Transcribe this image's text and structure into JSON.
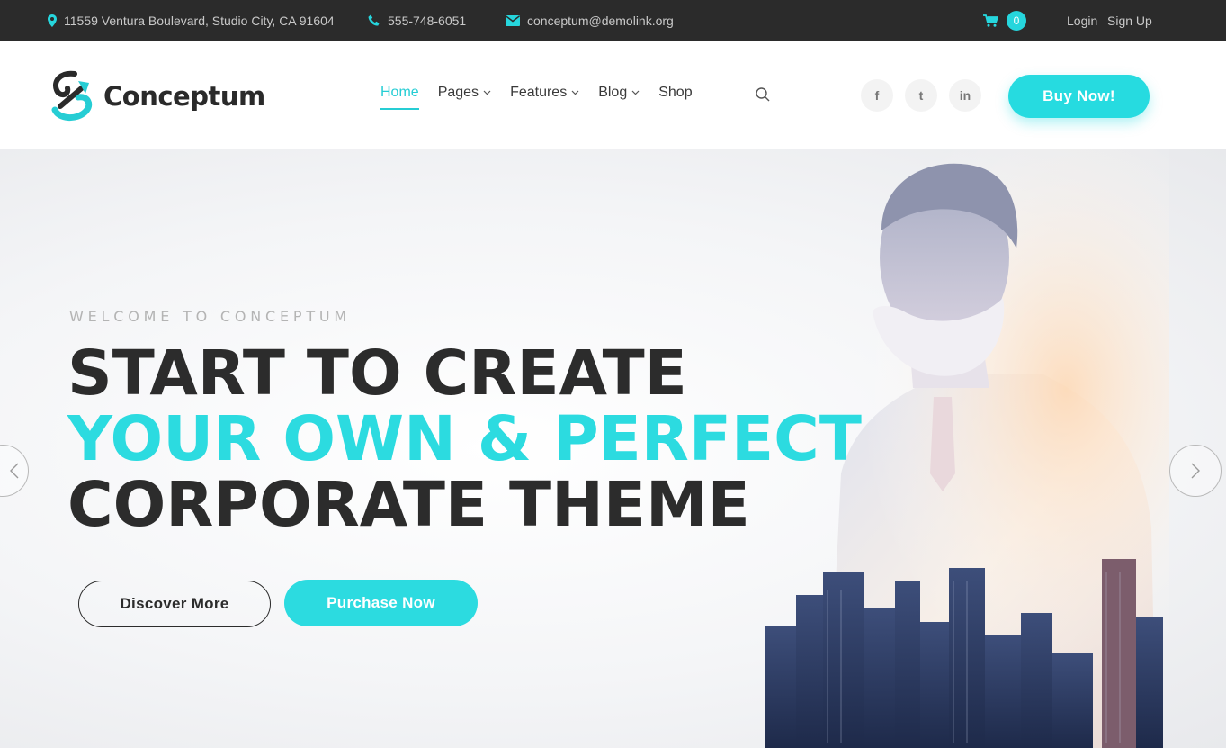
{
  "topbar": {
    "address": "11559 Ventura Boulevard, Studio City, CA 91604",
    "phone": "555-748-6051",
    "email": "conceptum@demolink.org",
    "cart_count": "0",
    "login": "Login",
    "signup": "Sign Up"
  },
  "header": {
    "logo_text": "Conceptum",
    "nav": [
      {
        "label": "Home",
        "active": true
      },
      {
        "label": "Pages",
        "dropdown": true
      },
      {
        "label": "Features",
        "dropdown": true
      },
      {
        "label": "Blog",
        "dropdown": true
      },
      {
        "label": "Shop"
      }
    ],
    "social": [
      {
        "icon": "facebook-icon",
        "glyph": "f"
      },
      {
        "icon": "twitter-icon",
        "glyph": "t"
      },
      {
        "icon": "linkedin-icon",
        "glyph": "in"
      }
    ],
    "buy_label": "Buy Now!"
  },
  "hero": {
    "eyebrow": "WELCOME TO CONCEPTUM",
    "line1": "START TO CREATE",
    "line2": "YOUR OWN & PERFECT",
    "line3": "CORPORATE THEME",
    "discover_label": "Discover More",
    "purchase_label": "Purchase Now"
  },
  "colors": {
    "accent": "#2cdbe0",
    "dark": "#2c2c2c",
    "topbar_bg": "#2b2b2b"
  }
}
